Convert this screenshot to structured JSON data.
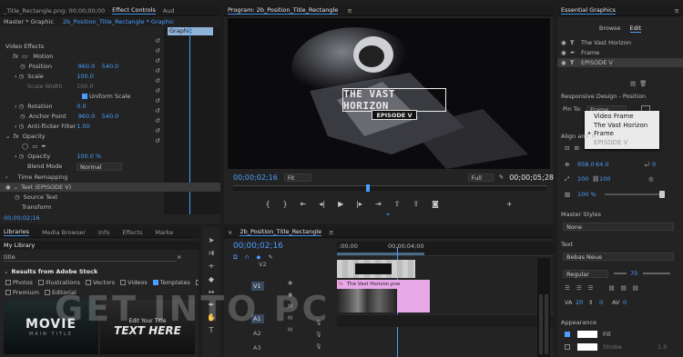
{
  "effect_controls": {
    "tabs": [
      "_Title_Rectangle.png: 00;00;00;00",
      "Effect Controls",
      "Aud"
    ],
    "master_label": "Master * Graphic",
    "clip_label": "2b_Position_Title_Rectangle * Graphic",
    "timeline_graphic_label": "Graphic",
    "video_effects": "Video Effects",
    "motion": "Motion",
    "position_label": "Position",
    "position_x": "960.0",
    "position_y": "540.0",
    "scale_label": "Scale",
    "scale_value": "100.0",
    "scale_width_label": "Scale Width",
    "scale_width_value": "100.0",
    "uniform_scale": "Uniform Scale",
    "rotation_label": "Rotation",
    "rotation_value": "0.0",
    "anchor_label": "Anchor Point",
    "anchor_x": "960.0",
    "anchor_y": "540.0",
    "antiflicker_label": "Anti-flicker Filter",
    "antiflicker_value": "1.00",
    "opacity": "Opacity",
    "opacity_label": "Opacity",
    "opacity_value": "100.0 %",
    "blend_label": "Blend Mode",
    "blend_value": "Normal",
    "time_remapping": "Time Remapping",
    "text_layer": "Text (EPISODE V)",
    "source_text": "Source Text",
    "transform": "Transform",
    "timecode": "00;00;02;16"
  },
  "program": {
    "title": "Program: 2b_Position_Title_Rectangle",
    "headline": "THE VAST HORIZON",
    "subline": "EPISODE V",
    "timecode": "00;00;02;16",
    "fit": "Fit",
    "quality": "Full",
    "duration": "00;00;05;28"
  },
  "essential_graphics": {
    "title": "Essential Graphics",
    "tabs": [
      "Browse",
      "Edit"
    ],
    "layers": [
      "The Vast Horizon",
      "Frame",
      "EPISODE V"
    ],
    "responsive_label": "Responsive Design - Position",
    "pin_to": "Pin To:",
    "pin_value": "Frame",
    "pin_options": [
      "Video Frame",
      "The Vast Horizon",
      "Frame",
      "EPISODE V"
    ],
    "align_label": "Align and Tr",
    "pos_x": "958.0",
    "pos_y": "64.0",
    "rot": "0",
    "scale_w": "100",
    "scale_h": "100",
    "opacity": "100 %",
    "master_styles": "Master Styles",
    "master_styles_value": "None",
    "text_label": "Text",
    "font": "Bebas Neue",
    "style": "Regular",
    "size": "70",
    "tracking": "20",
    "leading": "0",
    "kerning": "0",
    "appearance": "Appearance",
    "fill": "Fill",
    "stroke": "Stroke",
    "stroke_value": "1.0"
  },
  "libraries": {
    "tabs": [
      "Libraries",
      "Media Browser",
      "Info",
      "Effects",
      "Marke"
    ],
    "library": "My Library",
    "search": "title",
    "results": "Results from Adobe Stock",
    "filters": [
      "Photos",
      "Illustrations",
      "Vectors",
      "Videos",
      "Templates",
      "3D",
      "Premium",
      "Editorial"
    ],
    "thumb1_title": "MOVIE",
    "thumb1_sub": "MAIN TITLE",
    "thumb2_top": "Edit Your Title",
    "thumb2_title": "TEXT HERE"
  },
  "timeline": {
    "title": "2b_Position_Title_Rectangle",
    "timecode": "00;00;02;16",
    "ruler": [
      ":00;00",
      "00;00;04;00"
    ],
    "tracks": [
      "V2",
      "V1",
      "A1",
      "A2",
      "A3"
    ],
    "clip_title": "The Vast Horizon.pne"
  },
  "watermark": "GET INTO PC",
  "colors": {
    "accent": "#4a9eff",
    "clip_pink": "#e8a8e8",
    "panel": "#232323"
  }
}
